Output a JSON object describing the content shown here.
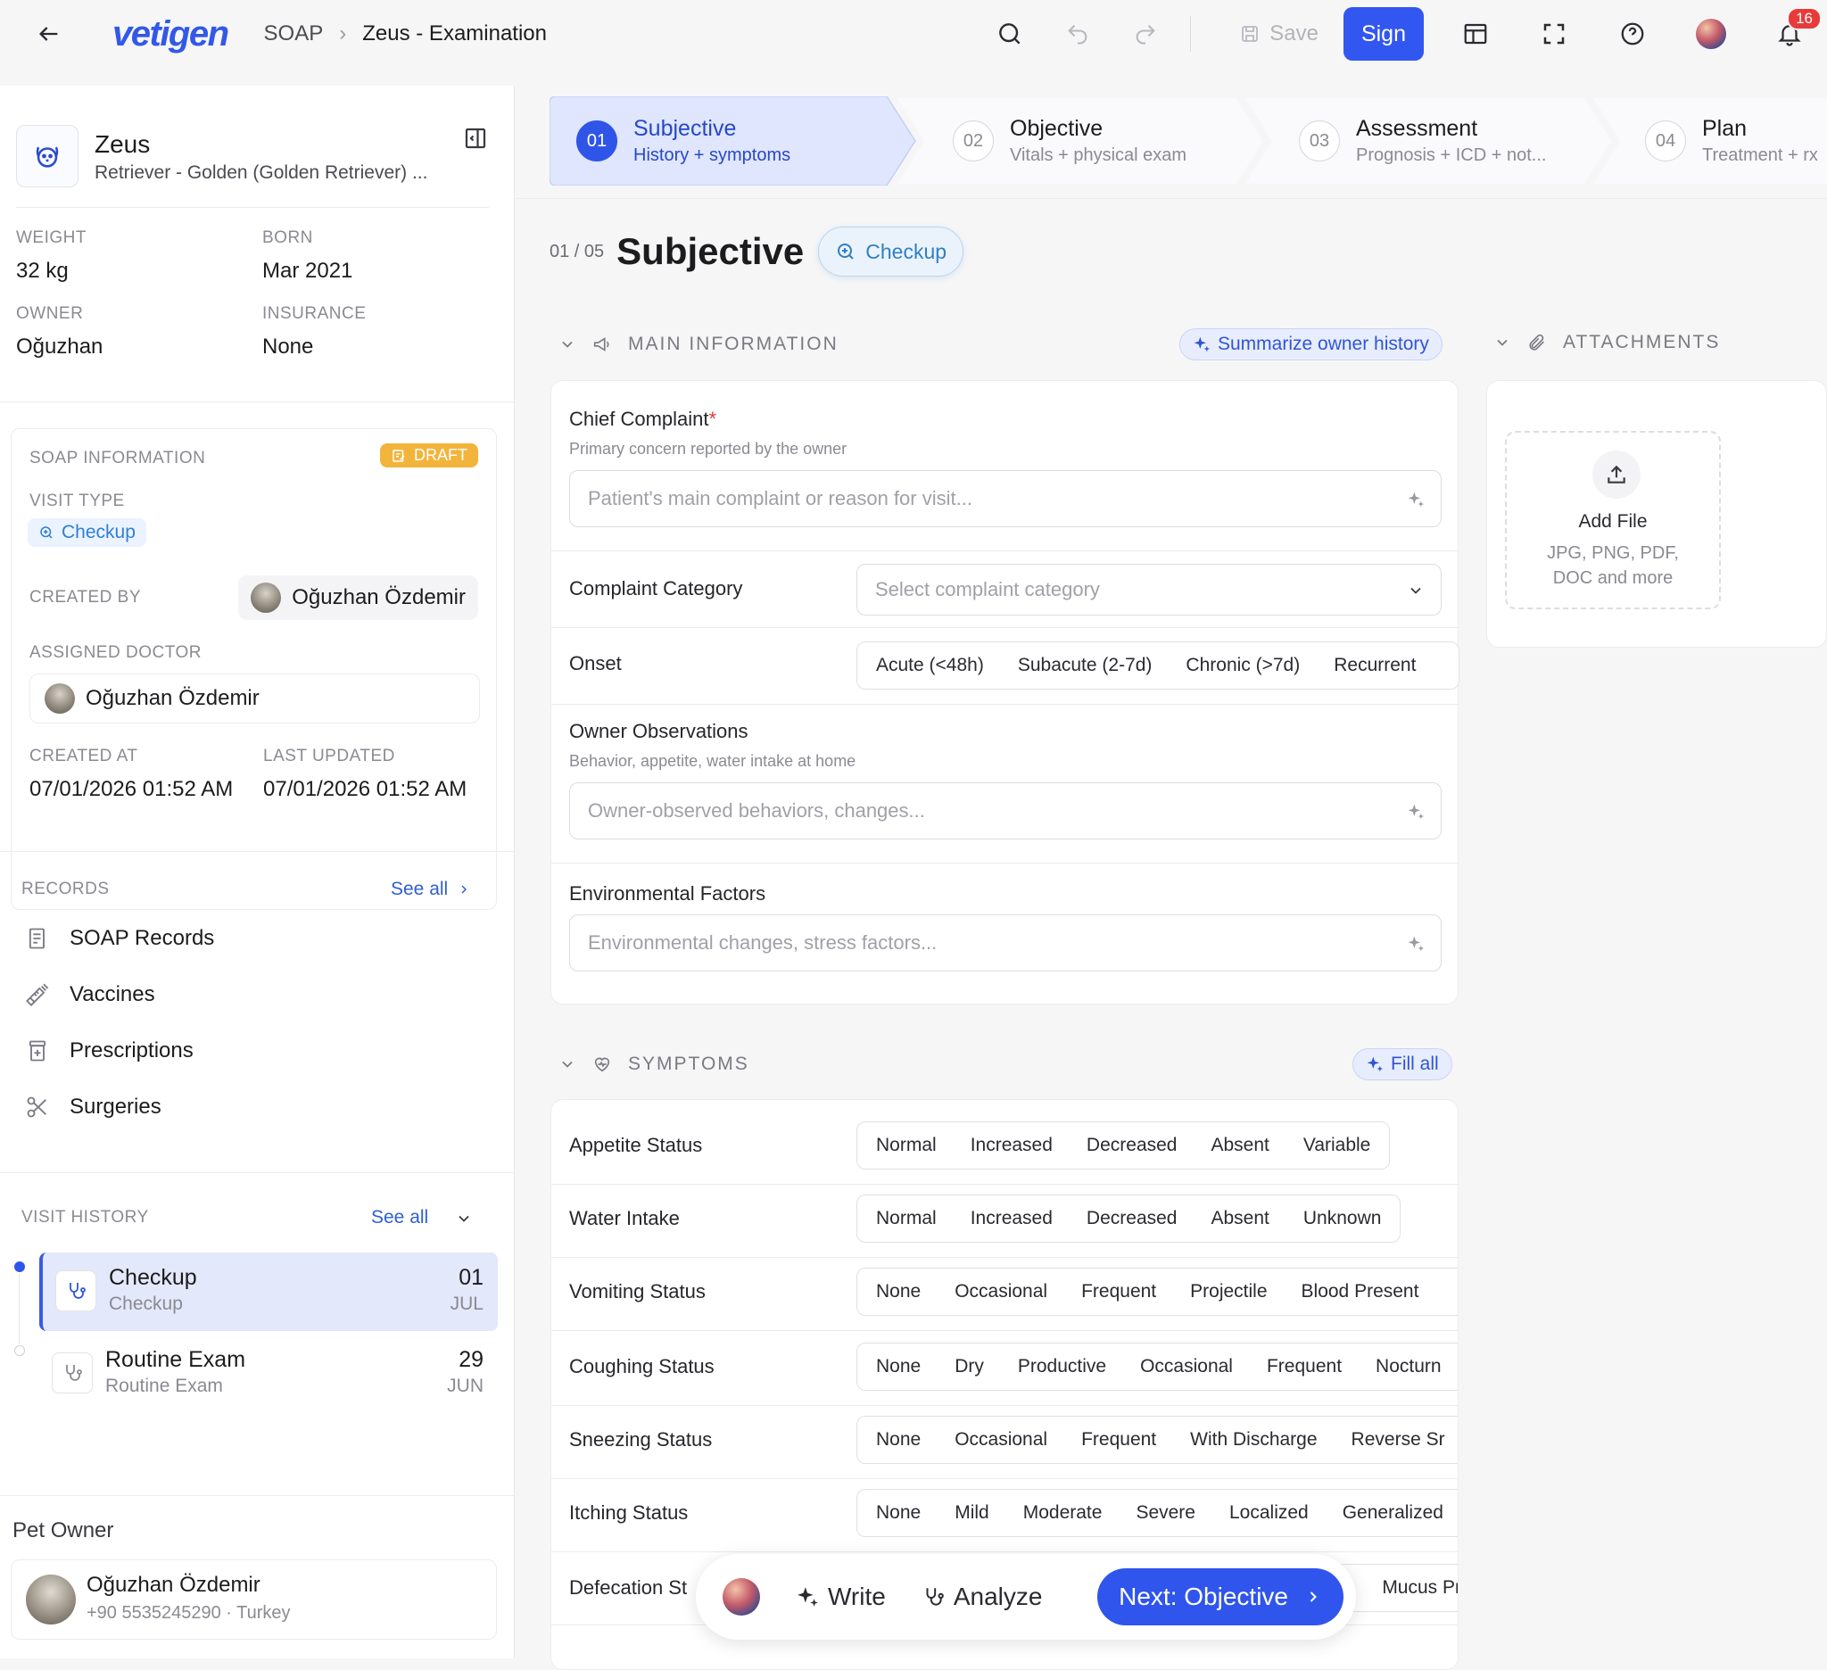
{
  "topbar": {
    "logo": "vetigen",
    "crumb_section": "SOAP",
    "crumb_current": "Zeus - Examination",
    "save_label": "Save",
    "sign_label": "Sign",
    "notifications_count": "16"
  },
  "pet": {
    "name": "Zeus",
    "breed": "Retriever - Golden (Golden Retriever) ...",
    "weight_label": "WEIGHT",
    "weight": "32 kg",
    "born_label": "BORN",
    "born": "Mar 2021",
    "owner_label": "OWNER",
    "owner": "Oğuzhan",
    "insurance_label": "INSURANCE",
    "insurance": "None"
  },
  "soap_info": {
    "title": "SOAP INFORMATION",
    "status": "DRAFT",
    "visit_type_label": "VISIT TYPE",
    "visit_type": "Checkup",
    "created_by_label": "CREATED BY",
    "created_by": "Oğuzhan Özdemir",
    "assigned_label": "ASSIGNED DOCTOR",
    "assigned": "Oğuzhan Özdemir",
    "created_at_label": "CREATED AT",
    "created_at": "07/01/2026 01:52 AM",
    "updated_label": "LAST UPDATED",
    "updated": "07/01/2026 01:52 AM"
  },
  "records": {
    "title": "RECORDS",
    "see_all": "See all",
    "items": [
      {
        "label": "SOAP Records",
        "icon": "document-icon"
      },
      {
        "label": "Vaccines",
        "icon": "syringe-icon"
      },
      {
        "label": "Prescriptions",
        "icon": "pill-bottle-icon"
      },
      {
        "label": "Surgeries",
        "icon": "scissors-icon"
      }
    ]
  },
  "visit_history": {
    "title": "VISIT HISTORY",
    "see_all": "See all",
    "items": [
      {
        "title": "Checkup",
        "sub": "Checkup",
        "day": "01",
        "month": "JUL"
      },
      {
        "title": "Routine Exam",
        "sub": "Routine Exam",
        "day": "29",
        "month": "JUN"
      }
    ]
  },
  "pet_owner": {
    "title": "Pet Owner",
    "name": "Oğuzhan Özdemir",
    "contact": "+90 5535245290 · Turkey"
  },
  "steps": [
    {
      "num": "01",
      "title": "Subjective",
      "sub": "History + symptoms"
    },
    {
      "num": "02",
      "title": "Objective",
      "sub": "Vitals + physical exam"
    },
    {
      "num": "03",
      "title": "Assessment",
      "sub": "Prognosis + ICD + not..."
    },
    {
      "num": "04",
      "title": "Plan",
      "sub": "Treatment + rx"
    }
  ],
  "main": {
    "counter": "01 / 05",
    "title": "Subjective",
    "visit_pill": "Checkup",
    "main_info_title": "MAIN INFORMATION",
    "summarize_label": "Summarize owner history",
    "attachments_title": "ATTACHMENTS",
    "chief_label": "Chief Complaint",
    "chief_required": "*",
    "chief_sub": "Primary concern reported by the owner",
    "chief_placeholder": "Patient's main complaint or reason for visit...",
    "category_label": "Complaint Category",
    "category_placeholder": "Select complaint category",
    "onset_label": "Onset",
    "onset_options": [
      "Acute (<48h)",
      "Subacute (2-7d)",
      "Chronic (>7d)",
      "Recurrent"
    ],
    "owner_obs_label": "Owner Observations",
    "owner_obs_sub": "Behavior, appetite, water intake at home",
    "owner_obs_placeholder": "Owner-observed behaviors, changes...",
    "env_label": "Environmental Factors",
    "env_placeholder": "Environmental changes, stress factors...",
    "symptoms_title": "SYMPTOMS",
    "fill_all": "Fill all"
  },
  "attachments": {
    "add_file": "Add File",
    "formats_line1": "JPG, PNG, PDF,",
    "formats_line2": "DOC and more"
  },
  "symptoms": [
    {
      "label": "Appetite Status",
      "options": [
        "Normal",
        "Increased",
        "Decreased",
        "Absent",
        "Variable"
      ]
    },
    {
      "label": "Water Intake",
      "options": [
        "Normal",
        "Increased",
        "Decreased",
        "Absent",
        "Unknown"
      ]
    },
    {
      "label": "Vomiting Status",
      "options": [
        "None",
        "Occasional",
        "Frequent",
        "Projectile",
        "Blood Present"
      ]
    },
    {
      "label": "Coughing Status",
      "options": [
        "None",
        "Dry",
        "Productive",
        "Occasional",
        "Frequent",
        "Nocturn"
      ]
    },
    {
      "label": "Sneezing Status",
      "options": [
        "None",
        "Occasional",
        "Frequent",
        "With Discharge",
        "Reverse Sr"
      ]
    },
    {
      "label": "Itching Status",
      "options": [
        "None",
        "Mild",
        "Moderate",
        "Severe",
        "Localized",
        "Generalized"
      ]
    },
    {
      "label": "Defecation St",
      "options": [
        "Mucus Pr"
      ]
    }
  ],
  "floatbar": {
    "write": "Write",
    "analyze": "Analyze",
    "next": "Next: Objective"
  }
}
